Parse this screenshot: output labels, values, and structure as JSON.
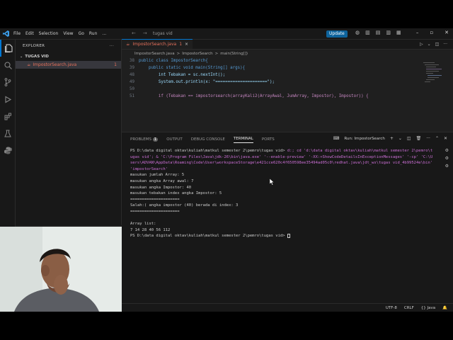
{
  "titlebar": {
    "menu": [
      "File",
      "Edit",
      "Selection",
      "View",
      "Go",
      "Run",
      "..."
    ],
    "search_text": "tugas vid",
    "update_label": "Update",
    "window_controls": [
      "minimize-icon",
      "maximize-icon",
      "close-icon"
    ]
  },
  "activity_icons": [
    "files-icon",
    "search-icon",
    "source-control-icon",
    "run-debug-icon",
    "extensions-icon",
    "testing-icon",
    "python-icon"
  ],
  "sidebar": {
    "title": "EXPLORER",
    "more": "···",
    "folder": "TUGAS VID",
    "file_name": "ImpostorSearch.java",
    "file_badge": "1"
  },
  "editor": {
    "tab_label": "ImpostorSearch.java",
    "tab_badge": "1",
    "tab_close": "×",
    "breadcrumb": [
      "ImpostorSearch.java",
      ">",
      "ImpostorSearch",
      ">",
      "main(String[])"
    ],
    "lines": [
      {
        "num": "38",
        "text": "public class ImpostorSearch{"
      },
      {
        "num": "39",
        "text": "    public static void main(String[] args){"
      },
      {
        "num": "48",
        "text": "        int Tebakan = sc.nextInt();"
      },
      {
        "num": "49",
        "text": "        System.out.println(x: \"=====================\");"
      },
      {
        "num": "50",
        "text": ""
      },
      {
        "num": "51",
        "text": "        if (Tebakan == impostorsearch(arrayKali2(ArrayAwal, JumArray, Impostor), Impostor)) {"
      }
    ]
  },
  "panel": {
    "tabs": [
      "PROBLEMS",
      "OUTPUT",
      "DEBUG CONSOLE",
      "TERMINAL",
      "PORTS"
    ],
    "problems_count": "1",
    "active_tab": "TERMINAL",
    "run_label": "Run: ImpostorSearch",
    "terminal": {
      "command_prompt": "PS D:\\data digital oktav\\kuliah\\matkul semester 2\\pemro\\tugas vid>",
      "command_text": " d:; cd 'd:\\data digital oktav\\kuliah\\matkul semester 2\\pemro\\tugas vid'; & 'C:\\Program Files\\Java\\jdk-26\\bin\\java.exe' '--enable-preview' '-XX:+ShowCodeDetailsInExceptionMessages' '-cp' 'C:\\Users\\ADVAN\\AppData\\Roaming\\Code\\User\\workspaceStorage\\e421cce620c4f650598ee35494ad05c0\\redhat.java\\jdt_ws\\tugas vid_4b99524e\\bin' 'impostorSearch'",
      "output": [
        "masukan jumlah Array: 5",
        "masukan angka Array awal: 7",
        "masukan angka Impostor: 40",
        "masukan tebakan index angka Impostor: 5",
        "=====================",
        "Salah:( angka impostor (40) berada di index: 3",
        "=====================",
        "",
        "Array list:",
        "7 14 28 40 56 112"
      ],
      "final_prompt": "PS D:\\data digital oktav\\kuliah\\matkul semester 2\\pemro\\tugas vid> "
    }
  },
  "statusbar": {
    "items": [
      "UTF-8",
      "CRLF",
      "{} Java"
    ]
  }
}
